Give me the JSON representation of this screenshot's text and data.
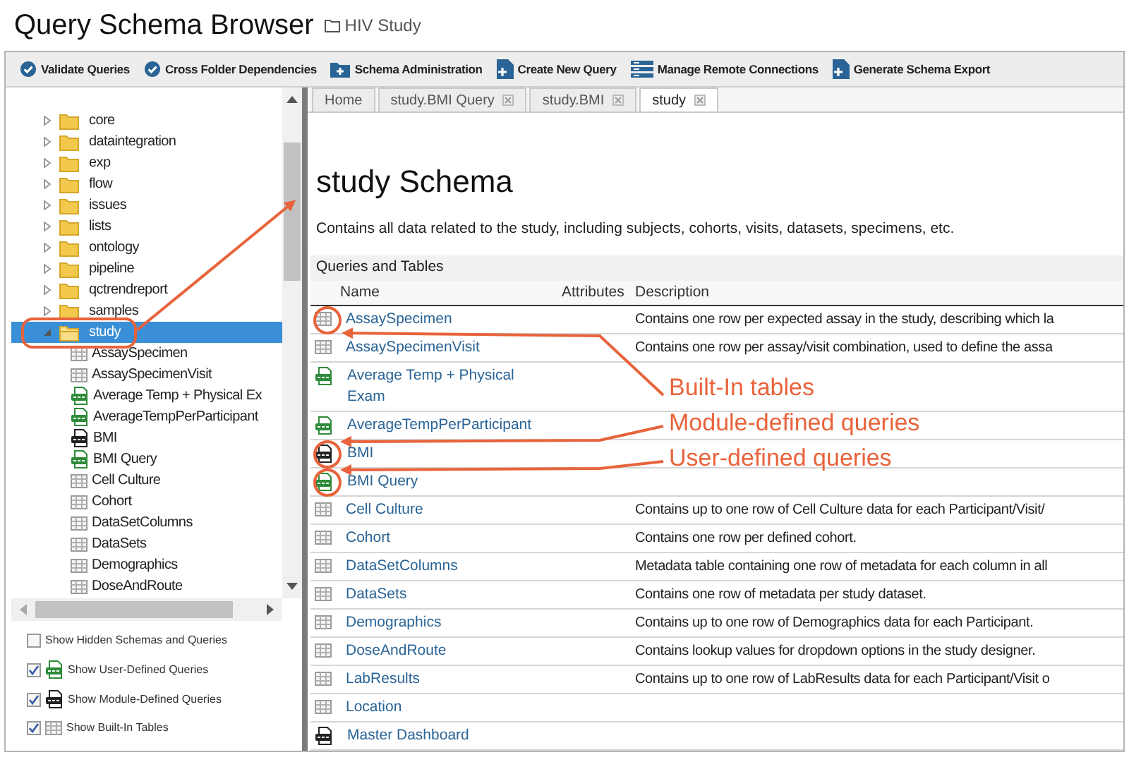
{
  "page": {
    "title": "Query Schema Browser",
    "folder": "HIV Study"
  },
  "toolbar": [
    {
      "label": "Validate Queries",
      "kind": "check"
    },
    {
      "label": "Cross Folder Dependencies",
      "kind": "check"
    },
    {
      "label": "Schema Administration",
      "kind": "folder"
    },
    {
      "label": "Create New Query",
      "kind": "file"
    },
    {
      "label": "Manage Remote Connections",
      "kind": "list"
    },
    {
      "label": "Generate Schema Export",
      "kind": "file"
    }
  ],
  "tree": [
    {
      "label": "core",
      "expanded": false,
      "selected": false
    },
    {
      "label": "dataintegration",
      "expanded": false,
      "selected": false
    },
    {
      "label": "exp",
      "expanded": false,
      "selected": false
    },
    {
      "label": "flow",
      "expanded": false,
      "selected": false
    },
    {
      "label": "issues",
      "expanded": false,
      "selected": false
    },
    {
      "label": "lists",
      "expanded": false,
      "selected": false
    },
    {
      "label": "ontology",
      "expanded": false,
      "selected": false
    },
    {
      "label": "pipeline",
      "expanded": false,
      "selected": false
    },
    {
      "label": "qctrendreport",
      "expanded": false,
      "selected": false
    },
    {
      "label": "samples",
      "expanded": false,
      "selected": false
    },
    {
      "label": "study",
      "expanded": true,
      "selected": true,
      "children": [
        {
          "label": "AssaySpecimen",
          "kind": "table"
        },
        {
          "label": "AssaySpecimenVisit",
          "kind": "table"
        },
        {
          "label": "Average Temp + Physical Ex",
          "kind": "user_query"
        },
        {
          "label": "AverageTempPerParticipant",
          "kind": "user_query"
        },
        {
          "label": "BMI",
          "kind": "module_query"
        },
        {
          "label": "BMI Query",
          "kind": "user_query"
        },
        {
          "label": "Cell Culture",
          "kind": "table"
        },
        {
          "label": "Cohort",
          "kind": "table"
        },
        {
          "label": "DataSetColumns",
          "kind": "table"
        },
        {
          "label": "DataSets",
          "kind": "table"
        },
        {
          "label": "Demographics",
          "kind": "table"
        },
        {
          "label": "DoseAndRoute",
          "kind": "table"
        }
      ]
    }
  ],
  "filters": [
    {
      "label": "Show Hidden Schemas and Queries",
      "checked": false,
      "kind": "none"
    },
    {
      "label": "Show User-Defined Queries",
      "checked": true,
      "kind": "user_query"
    },
    {
      "label": "Show Module-Defined Queries",
      "checked": true,
      "kind": "module_query"
    },
    {
      "label": "Show Built-In Tables",
      "checked": true,
      "kind": "table"
    }
  ],
  "tabs": [
    {
      "label": "Home",
      "closable": false,
      "selected": false
    },
    {
      "label": "study.BMI Query",
      "closable": true,
      "selected": false
    },
    {
      "label": "study.BMI",
      "closable": true,
      "selected": false
    },
    {
      "label": "study",
      "closable": true,
      "selected": true
    }
  ],
  "schema": {
    "title": "study Schema",
    "description": "Contains all data related to the study, including subjects, cohorts, visits, datasets, specimens, etc.",
    "section": "Queries and Tables",
    "columns": [
      "Name",
      "Attributes",
      "Description"
    ],
    "rows": [
      {
        "name": "AssaySpecimen",
        "kind": "table",
        "description": "Contains one row per expected assay in the study, describing which la"
      },
      {
        "name": "AssaySpecimenVisit",
        "kind": "table",
        "description": "Contains one row per assay/visit combination, used to define the assa"
      },
      {
        "name": "Average Temp + Physical Exam",
        "kind": "user_query"
      },
      {
        "name": "AverageTempPerParticipant",
        "kind": "user_query"
      },
      {
        "name": "BMI",
        "kind": "module_query"
      },
      {
        "name": "BMI Query",
        "kind": "user_query"
      },
      {
        "name": "Cell Culture",
        "kind": "table",
        "description": "Contains up to one row of Cell Culture data for each Participant/Visit/"
      },
      {
        "name": "Cohort",
        "kind": "table",
        "description": "Contains one row per defined cohort."
      },
      {
        "name": "DataSetColumns",
        "kind": "table",
        "description": "Metadata table containing one row of metadata for each column in all"
      },
      {
        "name": "DataSets",
        "kind": "table",
        "description": "Contains one row of metadata per study dataset."
      },
      {
        "name": "Demographics",
        "kind": "table",
        "description": "Contains up to one row of Demographics data for each Participant."
      },
      {
        "name": "DoseAndRoute",
        "kind": "table",
        "description": "Contains lookup values for dropdown options in the study designer."
      },
      {
        "name": "LabResults",
        "kind": "table",
        "description": "Contains up to one row of LabResults data for each Participant/Visit o"
      },
      {
        "name": "Location",
        "kind": "table"
      },
      {
        "name": "Master Dashboard",
        "kind": "module_query"
      }
    ]
  },
  "callouts": [
    {
      "text": "Built-In tables"
    },
    {
      "text": "Module-defined queries"
    },
    {
      "text": "User-defined queries"
    }
  ]
}
